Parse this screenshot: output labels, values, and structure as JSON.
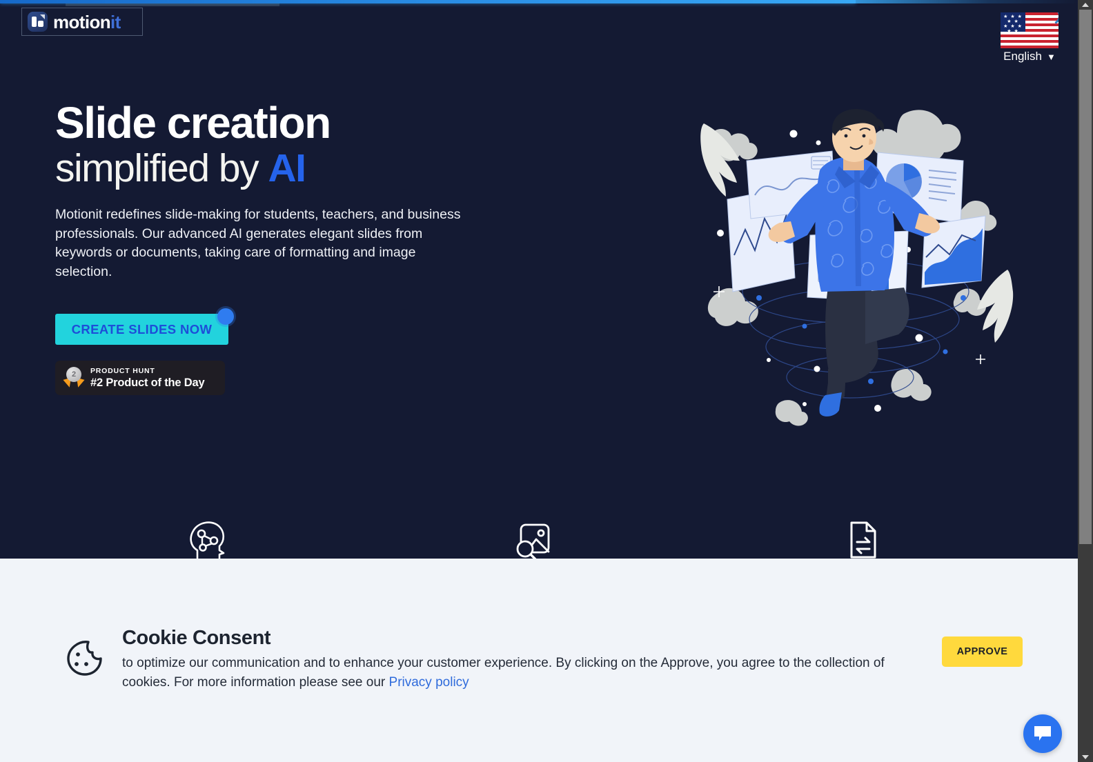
{
  "browser": {
    "loading_progress": 79,
    "scrollbar": {
      "thumb_position": "top",
      "thumb_fraction": 0.7
    }
  },
  "header": {
    "logo": {
      "name_main": "motion",
      "name_accent": "it",
      "icon": "slide-bars-icon"
    },
    "language_selector": {
      "label": "English",
      "caret": "▼",
      "flag": "us-flag-icon"
    }
  },
  "hero": {
    "headline_line1": "Slide creation",
    "headline_line2_plain": "simplified by ",
    "headline_line2_accent": "AI",
    "subtext": "Motionit redefines slide-making for students, teachers, and business professionals. Our advanced AI generates elegant slides from keywords or documents, taking care of formatting and image selection.",
    "cta_label": "CREATE SLIDES NOW",
    "product_hunt": {
      "kicker": "PRODUCT HUNT",
      "title": "#2 Product of the Day",
      "medal_rank": "2"
    },
    "illustration": "person-with-floating-slides-illustration"
  },
  "features": [
    {
      "icon": "ai-brain-head-icon",
      "name": "feature-ai"
    },
    {
      "icon": "image-search-icon",
      "name": "feature-image-search"
    },
    {
      "icon": "document-convert-icon",
      "name": "feature-document-convert"
    }
  ],
  "cookie_consent": {
    "icon": "cookie-icon",
    "title": "Cookie Consent",
    "text_part1": "to optimize our communication and to enhance your customer experience. By clicking on the Approve, you agree to the collection of cookies. For more information please see our ",
    "link_label": "Privacy policy",
    "approve_label": "APPROVE"
  },
  "chat_widget": {
    "icon": "chat-bubble-icon",
    "name": "chat-widget-button"
  },
  "colors": {
    "page_bg": "#141a33",
    "accent_blue": "#2563eb",
    "cta_cyan": "#22d3dd",
    "cta_text": "#1d4ed8",
    "approve_yellow": "#ffd93d",
    "cookie_bg": "#f1f4f9",
    "chat_blue": "#2a73f0",
    "badge_bg": "#1f1d24",
    "loadbar_blue": "#38a8f5"
  }
}
